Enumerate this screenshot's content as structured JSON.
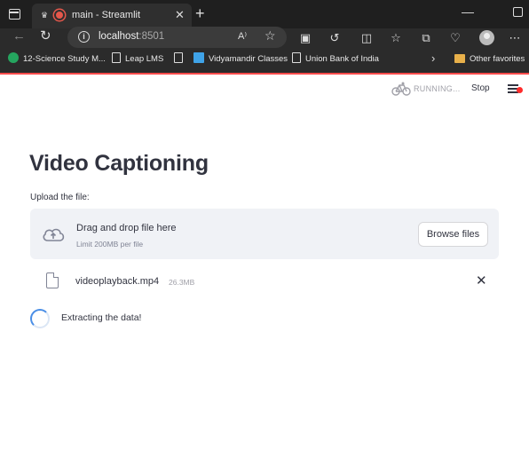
{
  "browser": {
    "tab_title": "main - Streamlit",
    "tab_close": "✕",
    "new_tab": "+",
    "url_host": "localhost",
    "url_port": ":8501",
    "read_aloud": "A⁾",
    "bookmarks": [
      {
        "label": "12-Science Study M...",
        "icon": "green-logo-icon"
      },
      {
        "label": "Leap LMS",
        "icon": "page-icon"
      },
      {
        "label": "Vidyamandir Classes",
        "icon": "blue-square-icon"
      },
      {
        "label": "Union Bank of India",
        "icon": "page-icon"
      }
    ],
    "other_favorites": "Other favorites"
  },
  "header": {
    "status": "RUNNING...",
    "stop": "Stop"
  },
  "main": {
    "title": "Video Captioning",
    "upload_label": "Upload the file:",
    "dropzone": {
      "title": "Drag and drop file here",
      "limit": "Limit 200MB per file",
      "browse": "Browse files"
    },
    "file": {
      "name": "videoplayback.mp4",
      "size": "26.3MB",
      "remove": "✕"
    },
    "spinner_text": "Extracting the data!"
  },
  "colors": {
    "accent": "#ff4b4b",
    "text": "#31333f",
    "dropzone_bg": "#f0f2f6",
    "spinner": "#4a8ee6"
  }
}
